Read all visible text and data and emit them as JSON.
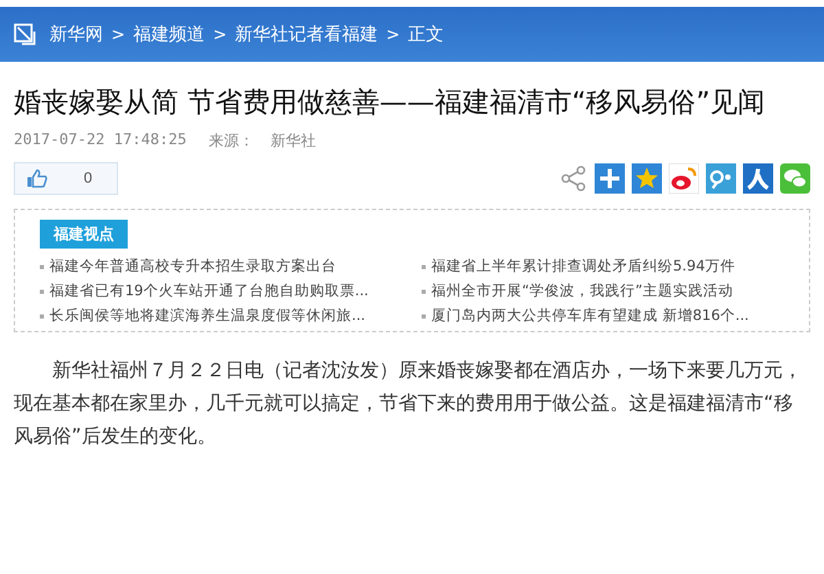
{
  "breadcrumb": [
    "新华网",
    "福建频道",
    "新华社记者看福建",
    "正文"
  ],
  "breadcrumb_separator": ">",
  "title": "婚丧嫁娶从简 节省费用做慈善——福建福清市“移风易俗”见闻",
  "meta": {
    "datetime": "2017-07-22 17:48:25",
    "source_label": "来源：",
    "source": "新华社"
  },
  "like": {
    "count": "0"
  },
  "share_icons": [
    {
      "kind": "share"
    },
    {
      "kind": "plus"
    },
    {
      "kind": "star"
    },
    {
      "kind": "weibo"
    },
    {
      "kind": "tencent"
    },
    {
      "kind": "renren"
    },
    {
      "kind": "wechat"
    }
  ],
  "news_box": {
    "heading": "福建视点",
    "items": [
      {
        "text": "福建今年普通高校专升本招生录取方案出台"
      },
      {
        "text": "福建省上半年累计排查调处矛盾纠纷5.94万件"
      },
      {
        "text": "福建省已有19个火车站开通了台胞自助购取票..."
      },
      {
        "text": "福州全市开展“学俊波，我践行”主题实践活动"
      },
      {
        "text": "长乐闽侯等地将建滨海养生温泉度假等休闲旅..."
      },
      {
        "text": "厦门岛内两大公共停车库有望建成 新增816个..."
      }
    ]
  },
  "article": "新华社福州７月２２日电（记者沈汝发）原来婚丧嫁娶都在酒店办，一场下来要几万元，现在基本都在家里办，几千元就可以搞定，节省下来的费用用于做公益。这是福建福清市“移风易俗”后发生的变化。"
}
